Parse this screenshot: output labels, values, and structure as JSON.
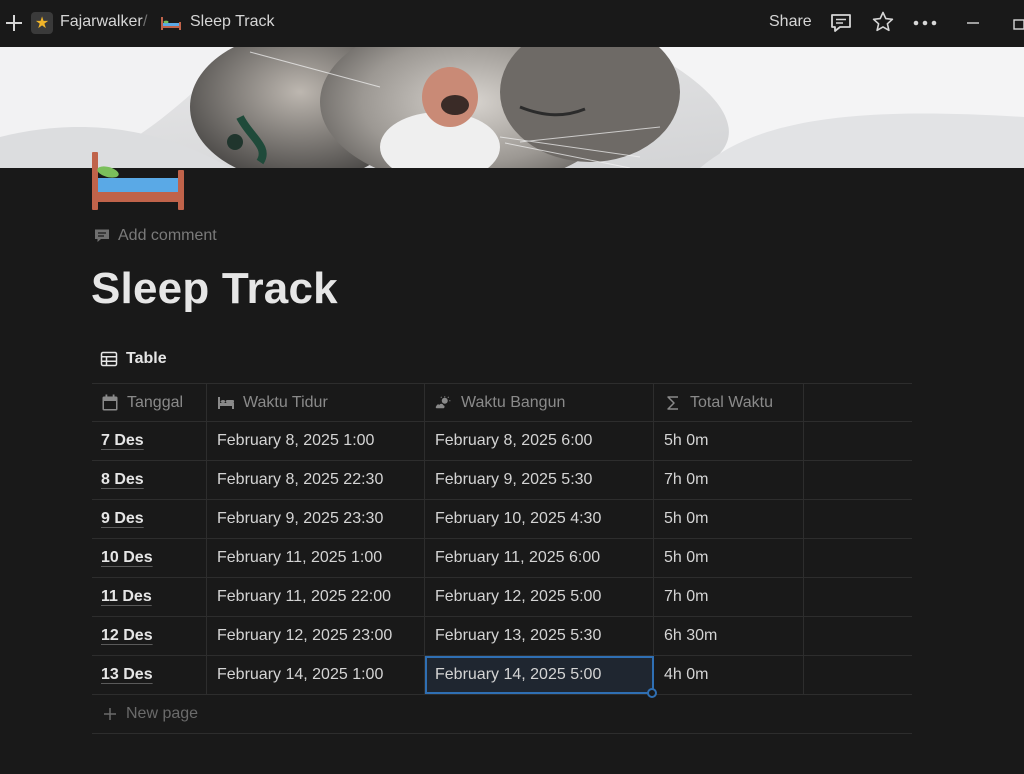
{
  "topbar": {
    "workspace": "Fajarwalker",
    "separator": "/",
    "page": "Sleep Track",
    "share_label": "Share"
  },
  "page": {
    "add_comment": "Add comment",
    "title": "Sleep Track",
    "view_label": "Table"
  },
  "table": {
    "columns": [
      {
        "label": "Tanggal",
        "icon": "calendar-icon"
      },
      {
        "label": "Waktu Tidur",
        "icon": "bed-icon"
      },
      {
        "label": "Waktu Bangun",
        "icon": "sun-cloud-icon"
      },
      {
        "label": "Total Waktu",
        "icon": "sigma-icon"
      }
    ],
    "rows": [
      {
        "tanggal": "7 Des",
        "tidur": "February 8, 2025 1:00",
        "bangun": "February 8, 2025 6:00",
        "total": "5h 0m"
      },
      {
        "tanggal": "8 Des",
        "tidur": "February 8, 2025 22:30",
        "bangun": "February 9, 2025 5:30",
        "total": "7h 0m"
      },
      {
        "tanggal": "9 Des",
        "tidur": "February 9, 2025 23:30",
        "bangun": "February 10, 2025 4:30",
        "total": "5h 0m"
      },
      {
        "tanggal": "10 Des",
        "tidur": "February 11, 2025 1:00",
        "bangun": "February 11, 2025 6:00",
        "total": "5h 0m"
      },
      {
        "tanggal": "11 Des",
        "tidur": "February 11, 2025 22:00",
        "bangun": "February 12, 2025 5:00",
        "total": "7h 0m"
      },
      {
        "tanggal": "12 Des",
        "tidur": "February 12, 2025 23:00",
        "bangun": "February 13, 2025 5:30",
        "total": "6h 30m"
      },
      {
        "tanggal": "13 Des",
        "tidur": "February 14, 2025 1:00",
        "bangun": "February 14, 2025 5:00",
        "total": "4h 0m"
      }
    ],
    "new_page": "New page"
  },
  "colors": {
    "background": "#191919",
    "selection": "#2f6fb3",
    "star": "#f0b429"
  }
}
